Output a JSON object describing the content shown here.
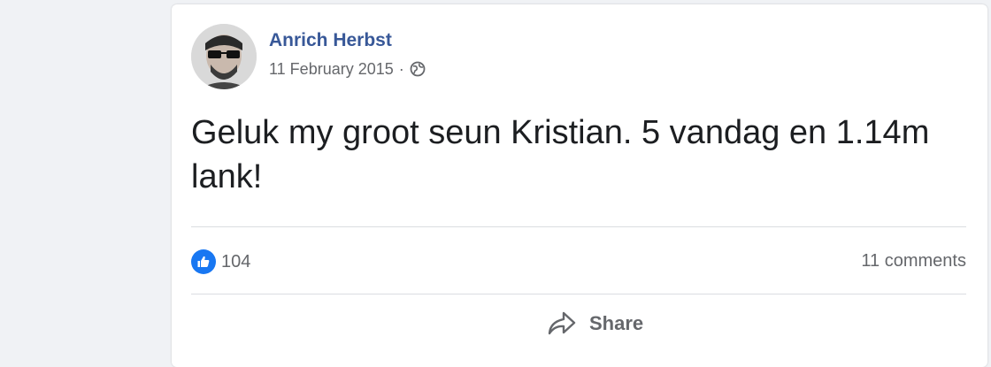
{
  "post": {
    "author": "Anrich Herbst",
    "date": "11 February 2015",
    "separator": "·",
    "privacy_icon": "globe-icon",
    "message": "Geluk my groot seun Kristian. 5 vandag en 1.14m lank!",
    "reactions": {
      "icon": "like-icon",
      "count": "104"
    },
    "comments": "11 comments",
    "actions": {
      "share_label": "Share",
      "share_icon": "share-icon"
    }
  },
  "colors": {
    "author": "#385898",
    "like_badge": "#1877f2",
    "secondary_text": "#65676b",
    "page_background": "#f0f2f5"
  }
}
